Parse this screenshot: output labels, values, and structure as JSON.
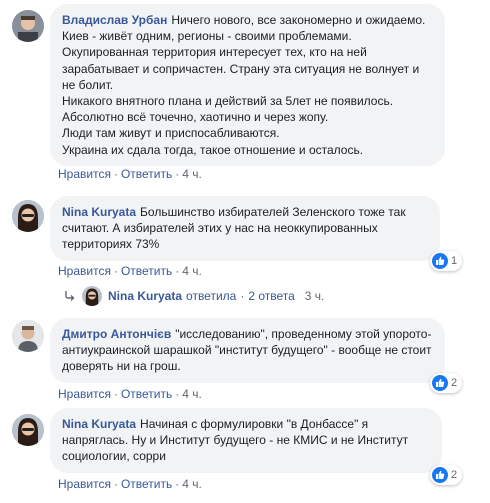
{
  "comments": [
    {
      "author": "Владислав Урбан",
      "text": "Ничего нового, все закономерно и ожидаемо.\nКиев - живёт одним, регионы - своими проблемами.\nОкупированная территория интересует тех, кто на ней зарабатывает и сопричастен. Страну эта ситуация не волнует и не болит.\nНикакого внятного плана и действий за 5лет не появилось.\nАбсолютно всё точечно, хаотично и через жопу.\nЛюди там живут и приспосабливаются.\nУкраина их сдала тогда, такое отношение и осталось.",
      "like": "Нравится",
      "reply": "Ответить",
      "time": "4 ч."
    },
    {
      "author": "Nina Kuryata",
      "text": "Большинство избирателей Зеленского тоже так считают. А избирателей этих у нас на неоккупированных территориях 73%",
      "like": "Нравится",
      "reply": "Ответить",
      "time": "4 ч.",
      "reaction_count": "1"
    },
    {
      "author": "Дмитро Антончiєв",
      "text": "\"исследованию\", проведенному этой упорото-антиукраинской шарашкой \"институт будущего\" - вообще не стоит доверять ни на грош.",
      "like": "Нравится",
      "reply": "Ответить",
      "time": "4 ч.",
      "reaction_count": "2"
    },
    {
      "author": "Nina Kuryata",
      "text": "Начиная с формулировки \"в Донбассе\" я напряглась. Ну и Институт будущего - не КМИС и не Институт социологии, сорри",
      "like": "Нравится",
      "reply": "Ответить",
      "time": "4 ч.",
      "reaction_count": "2"
    }
  ],
  "replies_summary": {
    "name": "Nina Kuryata",
    "verb": "ответила",
    "sep": "·",
    "count": "2 ответа",
    "time": "3 ч."
  },
  "colors": {
    "link": "#385898",
    "bubble": "#f2f3f5",
    "meta": "#606770",
    "like_blue": "#1877f2"
  }
}
